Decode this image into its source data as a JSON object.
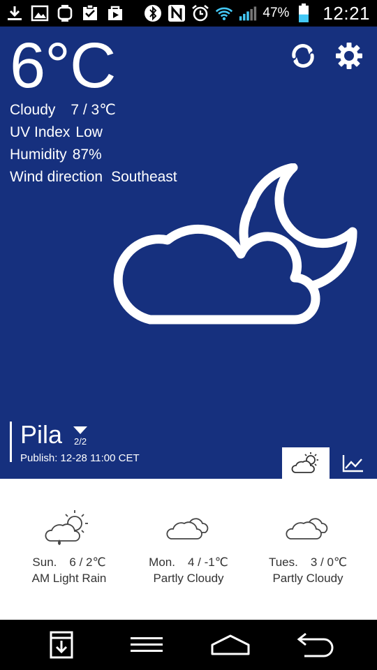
{
  "status_bar": {
    "left_icons": [
      "download-icon",
      "image-icon",
      "watch-icon",
      "clipboard-check-icon",
      "play-store-icon"
    ],
    "right_icons": [
      "bluetooth-icon",
      "nfc-icon",
      "alarm-icon",
      "wifi-icon",
      "signal-icon",
      "battery-icon"
    ],
    "battery_percent": "47%",
    "battery_level": 0.47,
    "time": "12:21"
  },
  "current": {
    "temperature": "6°C",
    "condition": "Cloudy",
    "range": "7 / 3℃",
    "uv_label": "UV Index",
    "uv_value": "Low",
    "humidity_label": "Humidity",
    "humidity_value": "87%",
    "wind_label": "Wind direction",
    "wind_value": "Southeast",
    "hero_icon": "cloudy-night-icon"
  },
  "actions": {
    "refresh_icon": "refresh-icon",
    "settings_icon": "settings-gear-icon"
  },
  "location": {
    "city": "Pila",
    "page_indicator": "2/2",
    "publish": "Publish: 12-28 11:00 CET"
  },
  "tabs": [
    {
      "icon": "partly-sunny-icon",
      "selected": true
    },
    {
      "icon": "line-chart-icon",
      "selected": false
    }
  ],
  "forecast": [
    {
      "day": "Sun.",
      "range": "6 / 2℃",
      "condition": "AM Light Rain",
      "icon": "sun-rain-icon"
    },
    {
      "day": "Mon.",
      "range": "4 / -1℃",
      "condition": "Partly Cloudy",
      "icon": "clouds-icon"
    },
    {
      "day": "Tues.",
      "range": "3 / 0℃",
      "condition": "Partly Cloudy",
      "icon": "clouds-icon"
    }
  ],
  "nav_bar": [
    "save-screen-icon",
    "menu-icon",
    "home-icon",
    "back-icon"
  ],
  "colors": {
    "panel_bg": "#16307e",
    "battery_fill": "#44c8f5",
    "wifi": "#44c8f5"
  }
}
